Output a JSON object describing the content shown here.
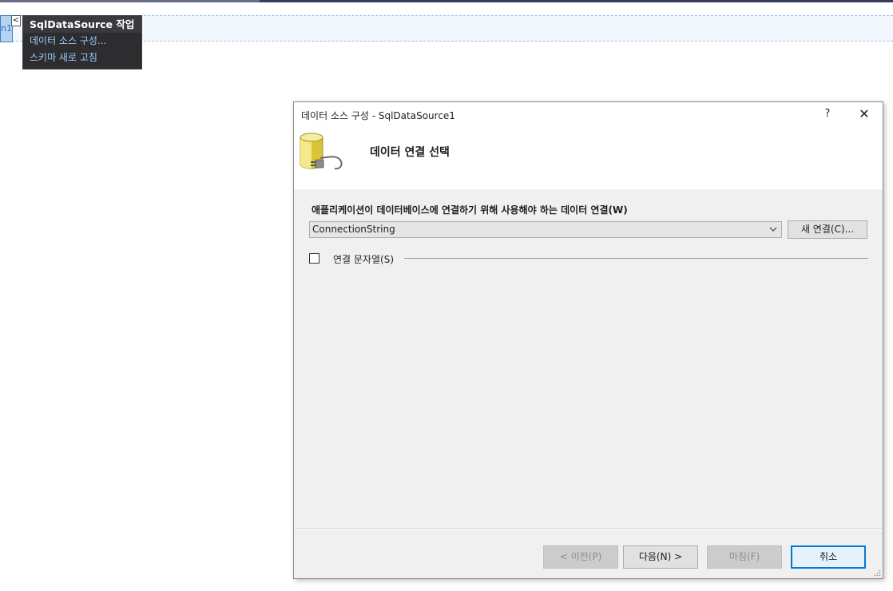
{
  "designer": {
    "control_tag_text": "n1",
    "smart_tag_glyph": "<",
    "tasks_panel": {
      "title": "SqlDataSource 작업",
      "items": [
        {
          "label": "데이터 소스 구성..."
        },
        {
          "label": "스키마 새로 고침"
        }
      ]
    }
  },
  "dialog": {
    "title": "데이터 소스 구성 - SqlDataSource1",
    "help_glyph": "?",
    "close_glyph": "✕",
    "heading": "데이터 연결 선택",
    "prompt": "애플리케이션이 데이터베이스에 연결하기 위해 사용해야 하는 데이터 연결(W)",
    "connection_combo": {
      "selected": "ConnectionString"
    },
    "new_connection_label": "새 연결(C)...",
    "connection_string_checkbox": {
      "label": "연결 문자열(S)",
      "checked": false
    },
    "buttons": {
      "prev": "< 이전(P)",
      "next": "다음(N) >",
      "finish": "마침(F)",
      "cancel": "취소"
    }
  },
  "colors": {
    "accent": "#0078d7",
    "tasks_panel_bg": "#2d2d30",
    "tasks_link": "#9ccaf6",
    "dialog_bg": "#f0f0f0",
    "db_icon": "#e8d64a"
  },
  "icons": {
    "banner": "database-plug-icon",
    "combo": "chevron-down-icon",
    "grip": "resize-grip-icon"
  }
}
